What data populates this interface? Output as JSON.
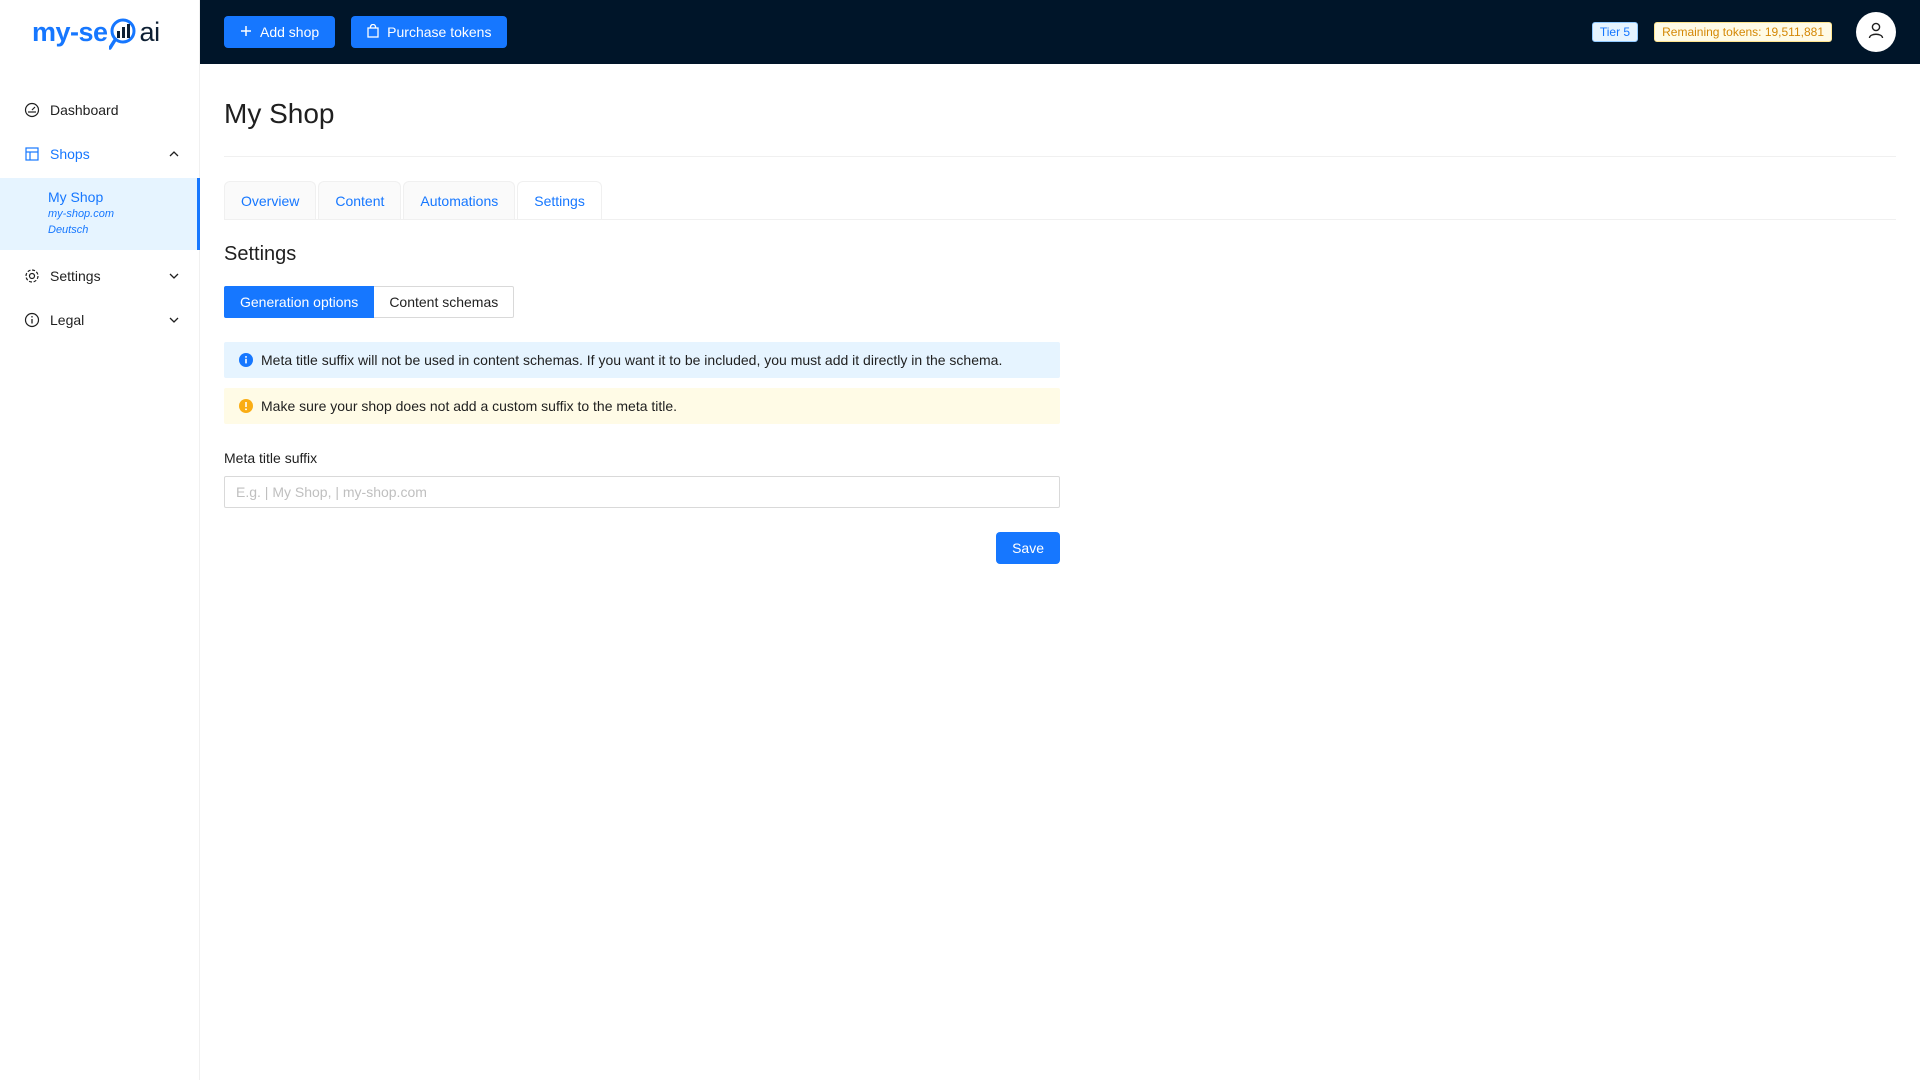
{
  "logo": {
    "part1": "my-se",
    "part2": "ai"
  },
  "sidebar": {
    "items": [
      {
        "label": "Dashboard"
      },
      {
        "label": "Shops"
      },
      {
        "label": "Settings"
      },
      {
        "label": "Legal"
      }
    ],
    "shop": {
      "name": "My Shop",
      "domain": "my-shop.com",
      "language": "Deutsch"
    }
  },
  "header": {
    "add_shop": "Add shop",
    "purchase_tokens": "Purchase tokens",
    "tier": "Tier 5",
    "remaining_tokens": "Remaining tokens: 19,511,881"
  },
  "main": {
    "page_title": "My Shop",
    "tabs": [
      {
        "label": "Overview"
      },
      {
        "label": "Content"
      },
      {
        "label": "Automations"
      },
      {
        "label": "Settings"
      }
    ],
    "section_title": "Settings",
    "segments": [
      {
        "label": "Generation options"
      },
      {
        "label": "Content schemas"
      }
    ],
    "alert_info": "Meta title suffix will not be used in content schemas. If you want it to be included, you must add it directly in the schema.",
    "alert_warning": "Make sure your shop does not add a custom suffix to the meta title.",
    "field_label": "Meta title suffix",
    "field_placeholder": "E.g. | My Shop, | my-shop.com",
    "field_value": "",
    "save_label": "Save"
  },
  "colors": {
    "primary": "#1677ff",
    "header_bg": "#001529",
    "info_bg": "#e6f4ff",
    "warning_bg": "#fffbe6",
    "warning_icon": "#faad14"
  }
}
